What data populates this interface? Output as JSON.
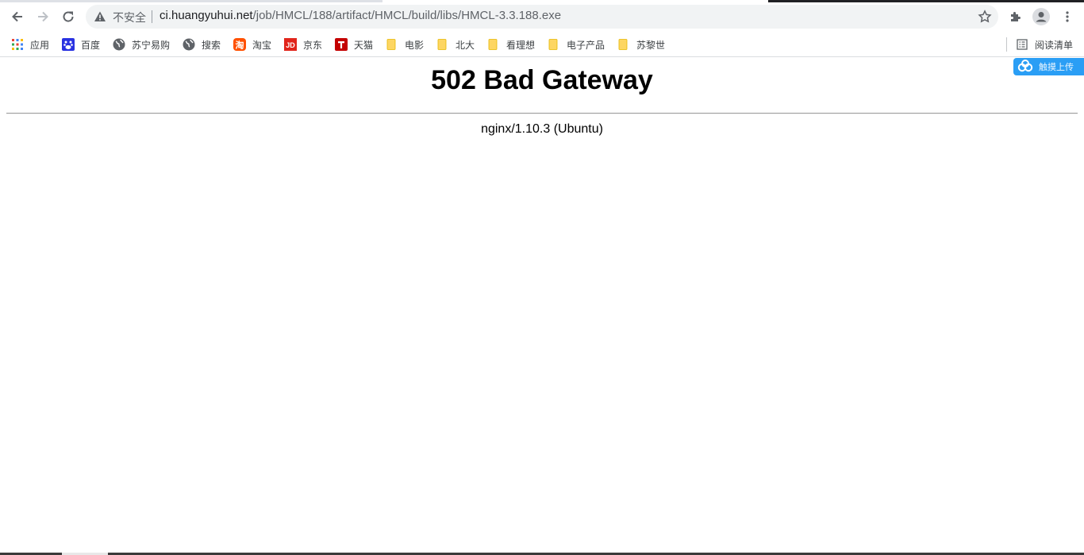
{
  "browser": {
    "security_label": "不安全",
    "url_host": "ci.huangyuhui.net",
    "url_path": "/job/HMCL/188/artifact/HMCL/build/libs/HMCL-3.3.188.exe"
  },
  "bookmarks": {
    "items": [
      {
        "label": "应用",
        "icon": "apps-grid-icon"
      },
      {
        "label": "百度",
        "icon": "baidu-icon"
      },
      {
        "label": "苏宁易购",
        "icon": "globe-icon"
      },
      {
        "label": "搜索",
        "icon": "globe-icon"
      },
      {
        "label": "淘宝",
        "icon": "taobao-icon"
      },
      {
        "label": "京东",
        "icon": "jd-icon"
      },
      {
        "label": "天猫",
        "icon": "tmall-icon"
      },
      {
        "label": "电影",
        "icon": "folder-icon"
      },
      {
        "label": "北大",
        "icon": "folder-icon"
      },
      {
        "label": "看理想",
        "icon": "folder-icon"
      },
      {
        "label": "电子产品",
        "icon": "folder-icon"
      },
      {
        "label": "苏黎世",
        "icon": "folder-icon"
      }
    ],
    "reading_list": "阅读清单"
  },
  "page": {
    "heading": "502 Bad Gateway",
    "server": "nginx/1.10.3 (Ubuntu)"
  },
  "widget": {
    "label": "触摸上传"
  },
  "colors": {
    "widget_blue": "#2a9ef5",
    "folder_yellow": "#fdd663",
    "jd_red": "#e1251b",
    "tmall_red": "#c40000",
    "taobao_orange": "#ff5000"
  }
}
